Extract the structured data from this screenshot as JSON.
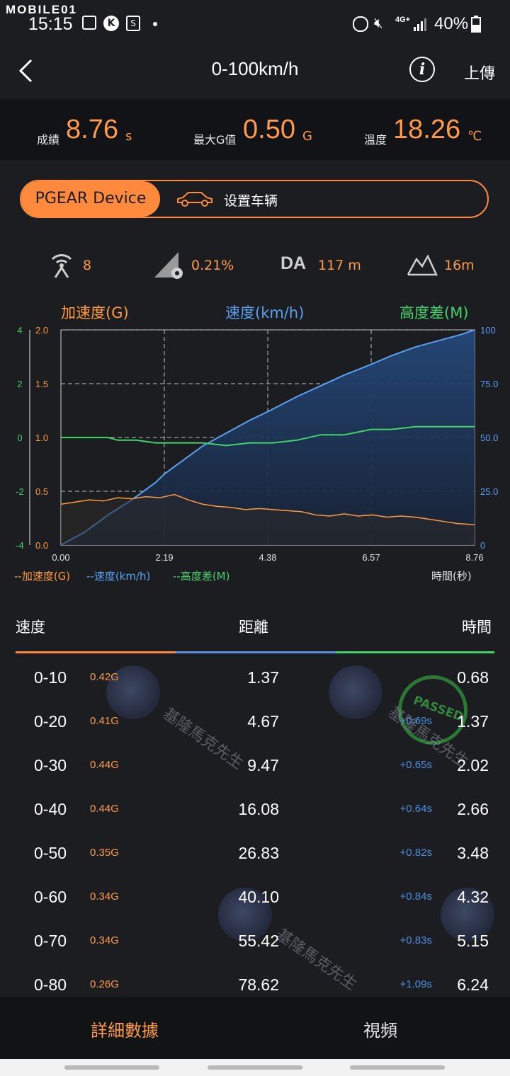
{
  "status_bar": {
    "brand": "MOBILE01",
    "time": "15:15",
    "network": "4G+",
    "battery": "40%"
  },
  "header": {
    "title": "0-100km/h",
    "upload_label": "上傳"
  },
  "stats": {
    "score_label": "成績",
    "score_value": "8.76",
    "score_unit": "s",
    "maxg_label": "最大G值",
    "maxg_value": "0.50",
    "maxg_unit": "G",
    "temp_label": "溫度",
    "temp_value": "18.26",
    "temp_unit": "℃"
  },
  "device": {
    "device_label": "PGEAR Device",
    "vehicle_label": "设置车辆"
  },
  "metrics": {
    "satellites": "8",
    "slope": "0.21%",
    "da_label": "DA",
    "da_value": "117 m",
    "altitude": "16m"
  },
  "chart_titles": {
    "accel": "加速度(G)",
    "speed": "速度(km/h)",
    "alt": "高度差(M)"
  },
  "legend": {
    "accel": "--加速度(G)",
    "speed": "--速度(km/h)",
    "alt": "--高度差(M)",
    "time": "時間(秒)"
  },
  "colors": {
    "accel": "#ff9a3c",
    "speed": "#5aa0f0",
    "alt": "#43d26a",
    "accent": "#ff8a3d"
  },
  "chart_data": {
    "type": "line",
    "x_ticks": [
      "0.00",
      "2.19",
      "4.38",
      "6.57",
      "8.76"
    ],
    "xlim": [
      0,
      8.76
    ],
    "xlabel": "時間(秒)",
    "left_outer_axis": {
      "label": "高度差(M)",
      "ticks": [
        "4",
        "2",
        "0",
        "-2",
        "-4"
      ],
      "lim": [
        -4,
        4
      ]
    },
    "left_inner_axis": {
      "label": "加速度(G)",
      "ticks": [
        "2.0",
        "1.5",
        "1.0",
        "0.5",
        "0.0"
      ],
      "lim": [
        0,
        2
      ]
    },
    "right_axis": {
      "label": "速度(km/h)",
      "ticks": [
        "100",
        "75.0",
        "50.0",
        "25.0",
        "0"
      ],
      "lim": [
        0,
        100
      ]
    },
    "series": [
      {
        "name": "速度(km/h)",
        "x": [
          0,
          0.5,
          1.0,
          1.5,
          2.0,
          2.19,
          2.5,
          3.0,
          3.5,
          4.0,
          4.38,
          5.0,
          5.5,
          6.0,
          6.57,
          7.0,
          7.5,
          8.0,
          8.5,
          8.76
        ],
        "values": [
          0,
          6,
          14,
          21,
          29,
          33,
          38,
          46,
          52,
          58,
          62,
          69,
          74,
          79,
          84,
          88,
          92,
          95,
          98,
          100
        ]
      },
      {
        "name": "加速度(G)",
        "x": [
          0,
          0.3,
          0.6,
          0.9,
          1.2,
          1.5,
          1.8,
          2.1,
          2.4,
          2.7,
          3.0,
          3.3,
          3.6,
          3.9,
          4.2,
          4.5,
          4.8,
          5.1,
          5.4,
          5.7,
          6.0,
          6.3,
          6.6,
          6.9,
          7.2,
          7.5,
          7.8,
          8.1,
          8.4,
          8.76
        ],
        "values": [
          0.38,
          0.4,
          0.42,
          0.41,
          0.44,
          0.43,
          0.45,
          0.44,
          0.47,
          0.42,
          0.38,
          0.36,
          0.35,
          0.33,
          0.34,
          0.33,
          0.32,
          0.31,
          0.28,
          0.27,
          0.29,
          0.27,
          0.28,
          0.26,
          0.27,
          0.26,
          0.24,
          0.22,
          0.2,
          0.19
        ]
      },
      {
        "name": "高度差(M)",
        "x": [
          0,
          0.5,
          1.0,
          1.2,
          1.6,
          2.0,
          2.5,
          3.0,
          3.5,
          4.0,
          4.5,
          5.0,
          5.5,
          6.0,
          6.57,
          7.0,
          7.5,
          8.0,
          8.76
        ],
        "values": [
          0,
          0,
          0,
          -0.1,
          -0.1,
          -0.2,
          -0.2,
          -0.2,
          -0.3,
          -0.2,
          -0.2,
          -0.1,
          0.1,
          0.1,
          0.3,
          0.3,
          0.4,
          0.4,
          0.4
        ]
      }
    ]
  },
  "table": {
    "headers": {
      "speed": "速度",
      "distance": "距離",
      "time": "時間"
    },
    "rows": [
      {
        "range": "0-10",
        "g": "0.42G",
        "distance": "1.37",
        "delta": "",
        "time": "0.68"
      },
      {
        "range": "0-20",
        "g": "0.41G",
        "distance": "4.67",
        "delta": "+0.69s",
        "time": "1.37"
      },
      {
        "range": "0-30",
        "g": "0.44G",
        "distance": "9.47",
        "delta": "+0.65s",
        "time": "2.02"
      },
      {
        "range": "0-40",
        "g": "0.44G",
        "distance": "16.08",
        "delta": "+0.64s",
        "time": "2.66"
      },
      {
        "range": "0-50",
        "g": "0.35G",
        "distance": "26.83",
        "delta": "+0.82s",
        "time": "3.48"
      },
      {
        "range": "0-60",
        "g": "0.34G",
        "distance": "40.10",
        "delta": "+0.84s",
        "time": "4.32"
      },
      {
        "range": "0-70",
        "g": "0.34G",
        "distance": "55.42",
        "delta": "+0.83s",
        "time": "5.15"
      },
      {
        "range": "0-80",
        "g": "0.26G",
        "distance": "78.62",
        "delta": "+1.09s",
        "time": "6.24"
      }
    ]
  },
  "watermark": {
    "text": "基隆馬克先生",
    "stamp": "PASSED"
  },
  "tabs": {
    "details": "詳細數據",
    "video": "視頻"
  }
}
